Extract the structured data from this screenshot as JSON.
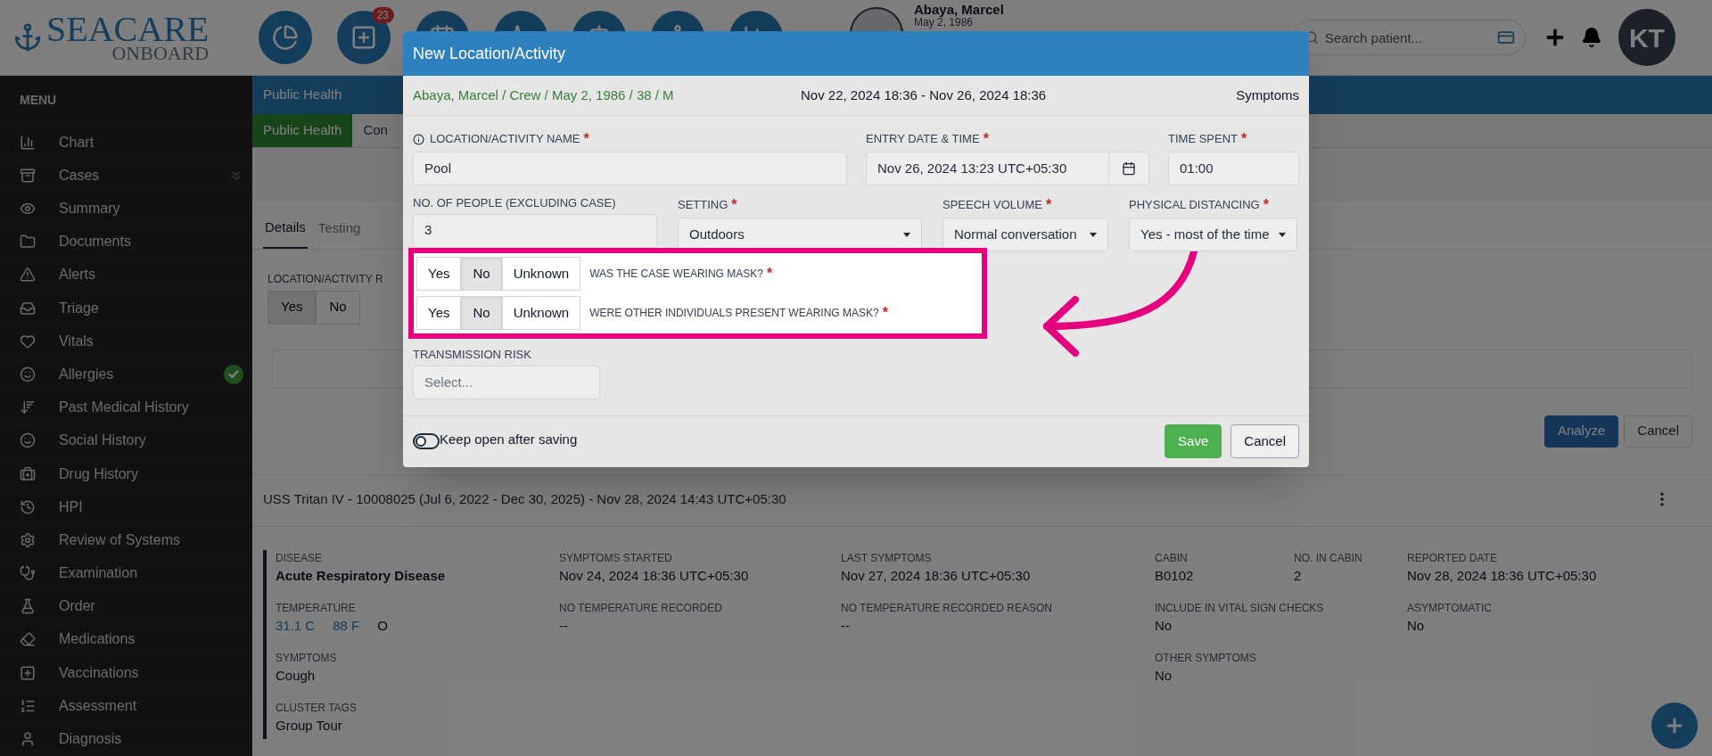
{
  "header": {
    "logo_main": "SEACARE",
    "logo_sub": "ONBOARD",
    "notification_count": "23",
    "patient_name": "Abaya, Marcel",
    "patient_dob": "May 2, 1986",
    "search": {
      "placeholder": "Search patient..."
    },
    "user_initials": "KT"
  },
  "sidebar": {
    "title": "MENU",
    "items": [
      {
        "label": "Chart"
      },
      {
        "label": "Cases",
        "expandable": true
      },
      {
        "label": "Summary"
      },
      {
        "label": "Documents"
      },
      {
        "label": "Alerts"
      },
      {
        "label": "Triage"
      },
      {
        "label": "Vitals"
      },
      {
        "label": "Allergies",
        "verified": true
      },
      {
        "label": "Past Medical History"
      },
      {
        "label": "Social History"
      },
      {
        "label": "Drug History"
      },
      {
        "label": "HPI"
      },
      {
        "label": "Review of Systems"
      },
      {
        "label": "Examination"
      },
      {
        "label": "Order"
      },
      {
        "label": "Medications"
      },
      {
        "label": "Vaccinations"
      },
      {
        "label": "Assessment"
      },
      {
        "label": "Diagnosis"
      }
    ]
  },
  "main": {
    "section_title": "Public Health",
    "tabs": [
      {
        "label": "Public Health",
        "selected": true
      },
      {
        "label": "Con",
        "selected": false
      }
    ],
    "subtabs": [
      {
        "label": "Details",
        "selected": true
      },
      {
        "label": "Testing",
        "selected": false
      }
    ],
    "location_field": {
      "label": "LOCATION/ACTIVITY R",
      "options": [
        {
          "label": "Yes",
          "selected": true
        },
        {
          "label": "No",
          "selected": false
        }
      ]
    },
    "actions": [
      "Analyze",
      "Cancel"
    ],
    "case": {
      "title": "USS Tritan IV - 10008025 (Jul 6, 2022 - Dec 30, 2025) - Nov 28, 2024 14:43 UTC+05:30",
      "rows": [
        [
          {
            "label": "DISEASE",
            "value": "Acute Respiratory Disease",
            "bold": true
          },
          {
            "label": "SYMPTOMS STARTED",
            "value": "Nov 24, 2024 18:36 UTC+05:30"
          },
          {
            "label": "LAST SYMPTOMS",
            "value": "Nov 27, 2024 18:36 UTC+05:30"
          },
          {
            "label": "CABIN",
            "value": "B0102"
          },
          {
            "label": "NO. IN CABIN",
            "value": "2"
          },
          {
            "label": "REPORTED DATE",
            "value": "Nov 28, 2024 18:36 UTC+05:30"
          }
        ],
        [
          {
            "label": "TEMPERATURE",
            "parts": [
              {
                "text": "31.1 C",
                "kind": "link"
              },
              {
                "text": "88 F",
                "kind": "link"
              },
              {
                "text": "O",
                "kind": "plain"
              }
            ]
          },
          {
            "label": "NO TEMPERATURE RECORDED",
            "value": "--"
          },
          {
            "label": "NO TEMPERATURE RECORDED REASON",
            "value": "--"
          },
          {
            "label": "INCLUDE IN VITAL SIGN CHECKS",
            "value": "No"
          },
          null,
          {
            "label": "ASYMPTOMATIC",
            "value": "No"
          }
        ],
        [
          {
            "label": "SYMPTOMS",
            "value": "Cough"
          },
          null,
          null,
          {
            "label": "OTHER SYMPTOMS",
            "value": "No"
          },
          null,
          null
        ],
        [
          {
            "label": "CLUSTER TAGS",
            "value": "Group Tour"
          },
          null,
          null,
          null,
          null,
          null
        ]
      ]
    }
  },
  "modal": {
    "title": "New Location/Activity",
    "patient": "Abaya, Marcel / Crew / May 2, 1986 / 38 / M",
    "period": "Nov 22, 2024 18:36 - Nov 26, 2024 18:36",
    "category": "Symptoms",
    "name_field": {
      "label": "LOCATION/ACTIVITY NAME",
      "required_mark": "*",
      "value": "Pool"
    },
    "entry_field": {
      "label": "ENTRY DATE & TIME",
      "required_mark": "*",
      "value": "Nov 26, 2024 13:23 UTC+05:30"
    },
    "time_field": {
      "label": "TIME SPENT",
      "required_mark": "*",
      "value": "01:00"
    },
    "people_field": {
      "label": "NO. OF PEOPLE (EXCLUDING CASE)",
      "value": "3"
    },
    "selects": [
      {
        "label": "SETTING",
        "required_mark": "*",
        "value": "Outdoors"
      },
      {
        "label": "SPEECH VOLUME",
        "required_mark": "*",
        "value": "Normal conversation"
      },
      {
        "label": "PHYSICAL DISTANCING",
        "required_mark": "*",
        "value": "Yes - most of the time"
      }
    ],
    "questions": [
      {
        "label": "WAS THE CASE WEARING MASK?",
        "required_mark": "*",
        "options": [
          {
            "label": "Yes",
            "selected": false
          },
          {
            "label": "No",
            "selected": true
          },
          {
            "label": "Unknown",
            "selected": false
          }
        ]
      },
      {
        "label": "WERE OTHER INDIVIDUALS PRESENT WEARING MASK?",
        "required_mark": "*",
        "options": [
          {
            "label": "Yes",
            "selected": false
          },
          {
            "label": "No",
            "selected": true
          },
          {
            "label": "Unknown",
            "selected": false
          }
        ]
      }
    ],
    "risk_field": {
      "label": "TRANSMISSION RISK",
      "placeholder": "Select..."
    },
    "keep_open": {
      "label": "Keep open after saving",
      "on": false
    },
    "buttons": [
      {
        "label": "Save",
        "kind": "primary"
      },
      {
        "label": "Cancel",
        "kind": "default"
      }
    ]
  }
}
